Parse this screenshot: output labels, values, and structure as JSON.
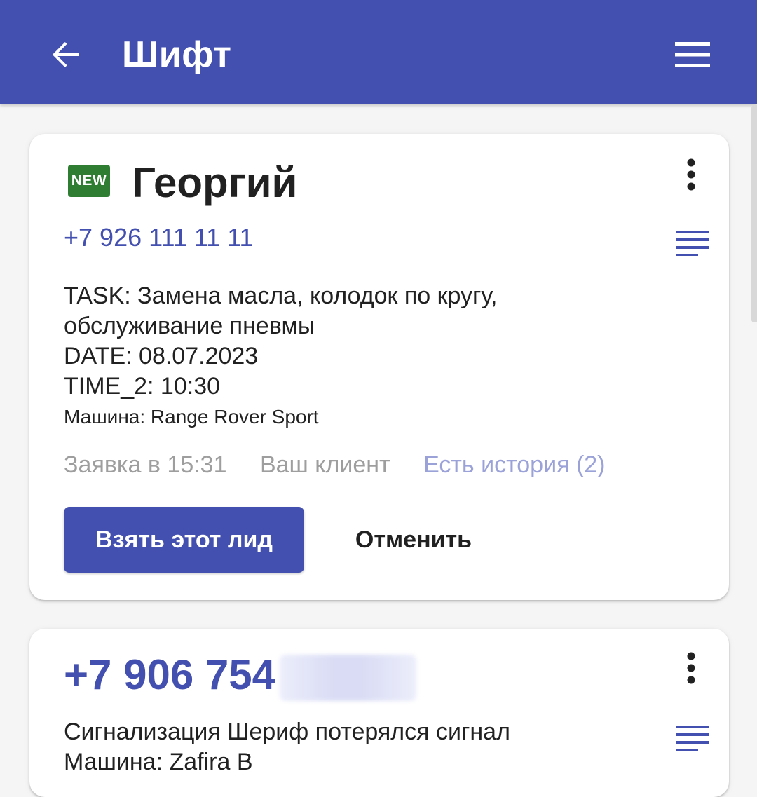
{
  "app_bar": {
    "title": "Шифт",
    "colors": {
      "primary": "#4350af",
      "on_primary": "#ffffff"
    },
    "icons": {
      "back": "arrow-back-icon",
      "menu": "hamburger-menu-icon"
    }
  },
  "leads": [
    {
      "badge": "NEW",
      "name": "Георгий",
      "phone": "+7 926 111 11 11",
      "description_lines": [
        "TASK: Замена масла, колодок по кругу,",
        "обслуживание пневмы",
        "DATE: 08.07.2023",
        "TIME_2: 10:30"
      ],
      "car": "Машина: Range Rover Sport",
      "meta": {
        "request_time": "Заявка в 15:31",
        "client_label": "Ваш клиент",
        "history_link": "Есть история (2)"
      },
      "actions": {
        "take": "Взять этот лид",
        "cancel": "Отменить"
      }
    },
    {
      "phone_visible": "+7 906 754",
      "description_lines": [
        "Сигнализация Шериф потерялся сигнал",
        "Машина: Zafira B"
      ]
    }
  ],
  "colors": {
    "badge_green": "#2e7d32",
    "accent_text": "#4350af",
    "muted_text": "#9e9e9e",
    "link_muted": "#9aa2d8",
    "background": "#f5f5f5",
    "card": "#ffffff"
  }
}
